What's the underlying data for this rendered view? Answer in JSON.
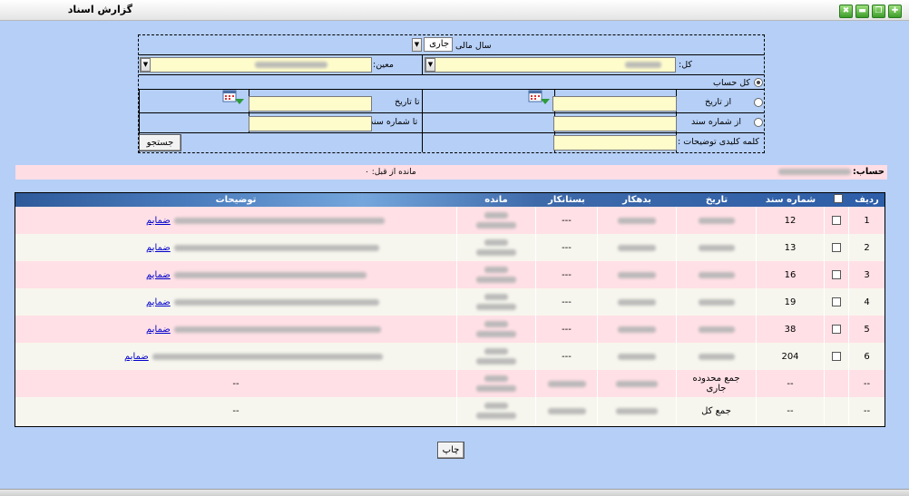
{
  "window": {
    "title": "گزارش اسناد",
    "buttons": [
      "✖",
      "▬",
      "❐",
      "✚"
    ]
  },
  "form": {
    "fiscal_year_label": "سال مالی",
    "fiscal_year_value": "جاری",
    "kol_label": "کل:",
    "moein_label": "معین:",
    "all_accounts_label": "کل حساب",
    "from_date_label": "از تاریخ",
    "to_date_label": "تا تاریخ",
    "from_doc_label": "از شماره سند",
    "to_doc_label": "تا شماره سند",
    "keyword_label": "کلمه کلیدی توضیحات :",
    "search_button": "جستجو"
  },
  "account": {
    "label": "حساب:",
    "prev_balance": "مانده از قبل: ۰"
  },
  "table": {
    "headers": {
      "radif": "ردیف",
      "doc_no": "شماره سند",
      "date": "تاریخ",
      "debit": "بدهکار",
      "credit": "بستانکار",
      "balance": "مانده",
      "desc": "توضیحات"
    },
    "attach_label": "ضمایم",
    "rows": [
      {
        "radif": "1",
        "doc_no": "12",
        "credit": "---"
      },
      {
        "radif": "2",
        "doc_no": "13",
        "credit": "---"
      },
      {
        "radif": "3",
        "doc_no": "16",
        "credit": "---"
      },
      {
        "radif": "4",
        "doc_no": "19",
        "credit": "---"
      },
      {
        "radif": "5",
        "doc_no": "38",
        "credit": "---"
      },
      {
        "radif": "6",
        "doc_no": "204",
        "credit": "---"
      }
    ],
    "sum_range": {
      "radif": "--",
      "doc_no": "--",
      "label": "جمع محدوده جاری",
      "desc": "--"
    },
    "sum_total": {
      "radif": "--",
      "doc_no": "--",
      "label": "جمع کل",
      "desc": "--"
    }
  },
  "print_button": "چاپ"
}
